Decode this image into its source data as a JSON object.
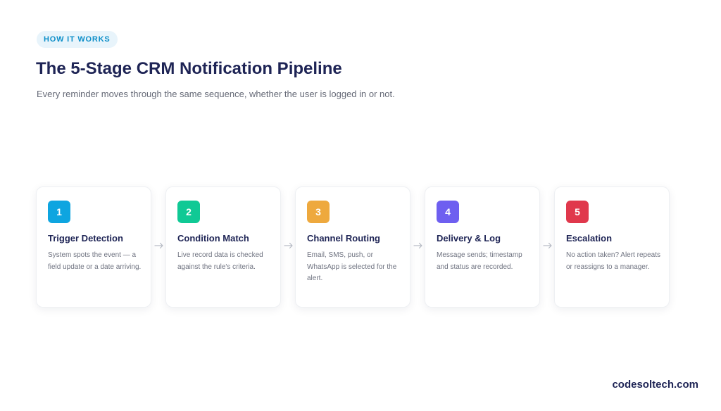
{
  "badge": "HOW IT WORKS",
  "title": "The 5-Stage CRM Notification Pipeline",
  "subtitle": "Every reminder moves through the same sequence, whether the user is logged in or not.",
  "colors": {
    "stage_1": "#0ea5e0",
    "stage_2": "#10c995",
    "stage_3": "#eea93e",
    "stage_4": "#6e5ff0",
    "stage_5": "#e0384c"
  },
  "stages": [
    {
      "number": "1",
      "name": "Trigger Detection",
      "description": "System spots the event — a field update or a date arriving."
    },
    {
      "number": "2",
      "name": "Condition Match",
      "description": "Live record data is checked against the rule's criteria."
    },
    {
      "number": "3",
      "name": "Channel Routing",
      "description": "Email, SMS, push, or WhatsApp is selected for the alert."
    },
    {
      "number": "4",
      "name": "Delivery & Log",
      "description": "Message sends; timestamp and status are recorded."
    },
    {
      "number": "5",
      "name": "Escalation",
      "description": "No action taken? Alert repeats or reassigns to a manager."
    }
  ],
  "arrow_icon": "arrow-right-icon",
  "brand": "codesoltech.com"
}
